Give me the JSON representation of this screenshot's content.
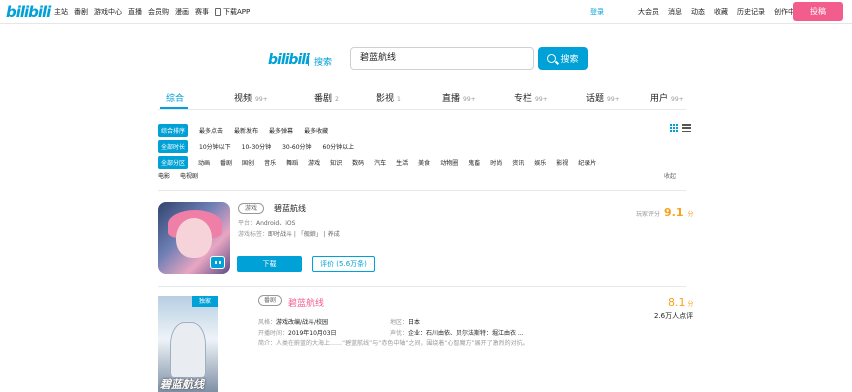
{
  "topbar": {
    "logo": "bilibili",
    "nav": [
      "主站",
      "番剧",
      "游戏中心",
      "直播",
      "会员购",
      "漫画",
      "赛事",
      "下载APP"
    ],
    "login": "登录",
    "right_nav": [
      "大会员",
      "消息",
      "动态",
      "收藏",
      "历史记录",
      "创作中心"
    ],
    "upload": "投稿"
  },
  "search": {
    "logo": "bilibili",
    "label": "搜索",
    "query": "碧蓝航线",
    "button": "搜索"
  },
  "tabs": [
    {
      "label": "综合",
      "count": ""
    },
    {
      "label": "视频",
      "count": "99+"
    },
    {
      "label": "番剧",
      "count": "2"
    },
    {
      "label": "影视",
      "count": "1"
    },
    {
      "label": "直播",
      "count": "99+"
    },
    {
      "label": "专栏",
      "count": "99+"
    },
    {
      "label": "话题",
      "count": "99+"
    },
    {
      "label": "用户",
      "count": "99+"
    }
  ],
  "filters": {
    "order": [
      "综合排序",
      "最多点击",
      "最新发布",
      "最多弹幕",
      "最多收藏"
    ],
    "duration": [
      "全部时长",
      "10分钟以下",
      "10-30分钟",
      "30-60分钟",
      "60分钟以上"
    ],
    "zones": [
      "全部分区",
      "动画",
      "番剧",
      "国创",
      "音乐",
      "舞蹈",
      "游戏",
      "知识",
      "数码",
      "汽车",
      "生活",
      "美食",
      "动物圈",
      "鬼畜",
      "时尚",
      "资讯",
      "娱乐",
      "影视",
      "纪录片"
    ],
    "zones_row2": [
      "电影",
      "电视剧"
    ],
    "fold": "收起"
  },
  "game": {
    "tag": "游戏",
    "title": "碧蓝航线",
    "platform_label": "平台：",
    "platform": "Android、iOS",
    "dev_label": "游戏标签：",
    "dev": "即时战斗 | 「舰娘」 | 养成",
    "score_label": "玩家评分",
    "score": "9.1",
    "score_unit": "分",
    "download": "下载",
    "rate": "评价 (5.6万条)"
  },
  "anime": {
    "badge": "独家",
    "tag": "番剧",
    "title": "碧蓝航线",
    "score": "8.1",
    "score_unit": "分",
    "count": "2.6万人点评",
    "cover_title": "碧蓝航线",
    "style_label": "风格：",
    "style": "游戏改编/战斗/校园",
    "area_label": "地区：",
    "area": "日本",
    "date_label": "开播时间：",
    "date": "2019年10月03日",
    "cv_label": "声优：",
    "cv": "企业：石川由依、贝尔法斯特：堀江由衣 ...",
    "synopsis": "简介：人类在蔚蓝的大海上……“碧蓝航线”与“赤色中轴”之间，围绕着“心智魔方”展开了激烈的对抗。"
  }
}
